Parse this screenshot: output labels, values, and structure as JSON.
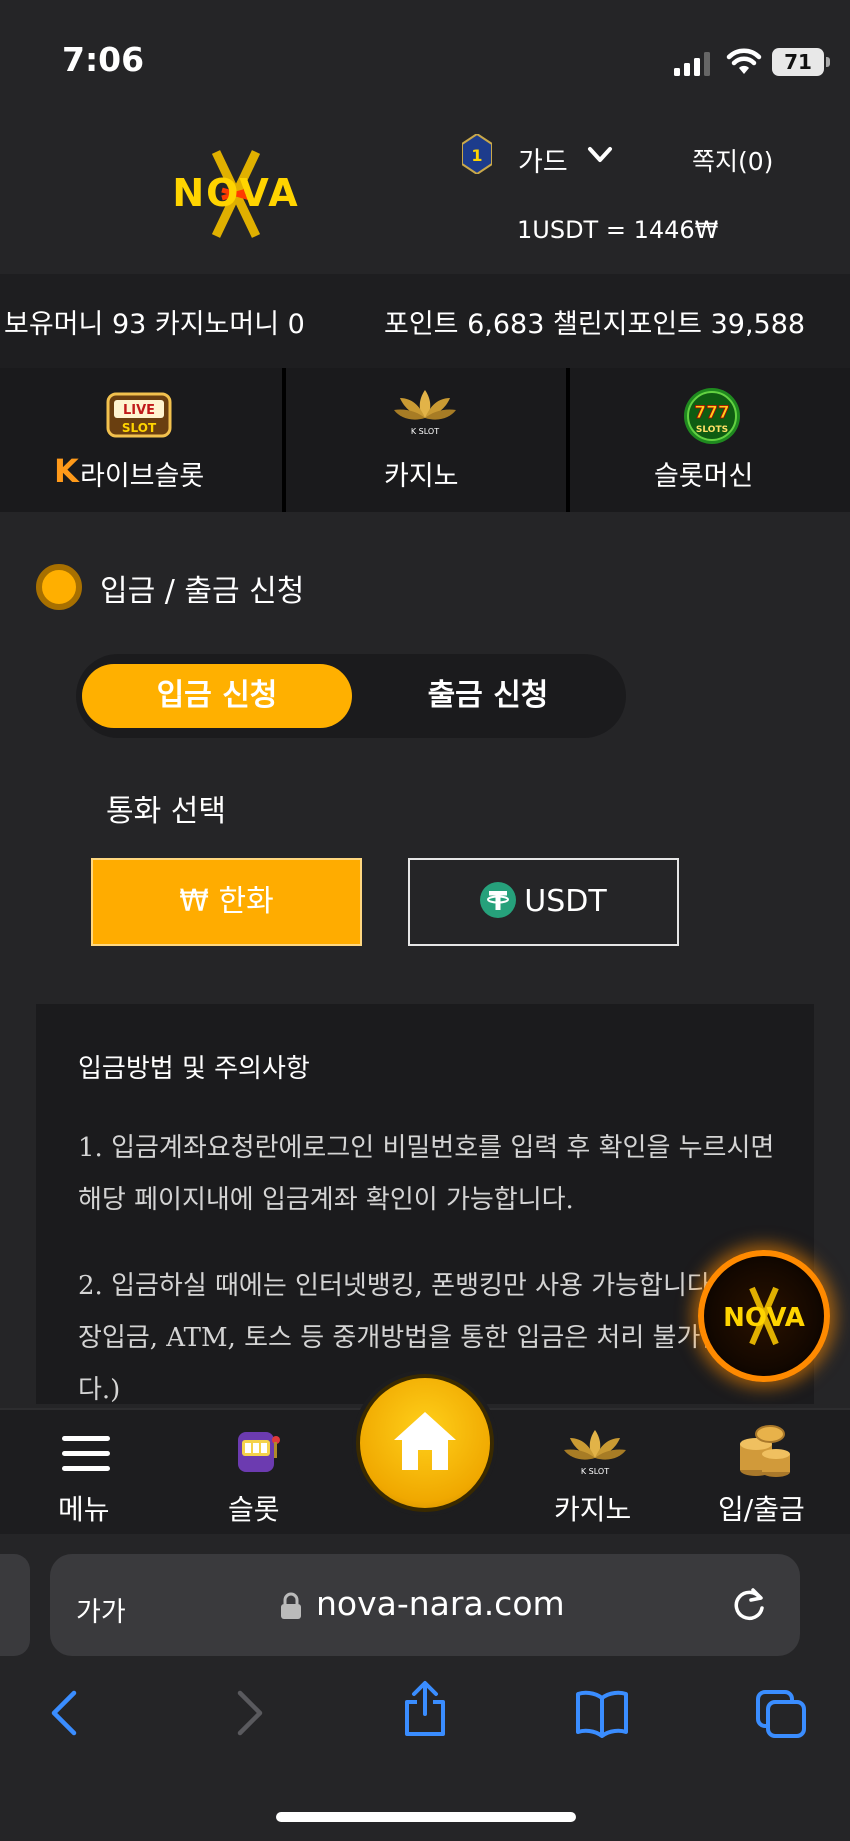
{
  "status_bar": {
    "time": "7:06",
    "battery": "71"
  },
  "header": {
    "logo_text": "NOVA",
    "level_badge": "1",
    "level_name": "가드",
    "message_link": "쪽지(0)",
    "usdt_rate": "1USDT = 1446₩"
  },
  "balances": {
    "left": "보유머니 93 카지노머니 0",
    "right": "포인트 6,683 챌린지포인트 39,588"
  },
  "categories": [
    {
      "icon": "live-slot-icon",
      "icon_text": "LIVE",
      "icon_subtext": "SLOT",
      "label": "라이브슬롯",
      "prefix": "K"
    },
    {
      "icon": "k-slot-lotus-icon",
      "icon_text": "K SLOT",
      "label": "카지노"
    },
    {
      "icon": "777-slots-icon",
      "icon_text": "777",
      "icon_subtext": "SLOTS",
      "label": "슬롯머신"
    }
  ],
  "section": {
    "title": "입금 / 출금 신청",
    "tabs": {
      "deposit": "입금 신청",
      "withdraw": "출금 신청"
    },
    "currency_title": "통화 선택",
    "currency_krw": "₩ 한화",
    "currency_usdt": "USDT"
  },
  "notice": {
    "title": "입금방법 및 주의사항",
    "p1": "1. 입금계좌요청란에로그인 비밀번호를 입력 후 확인을 누르시면 해당 페이지내에 입금계좌 확인이 가능합니다.",
    "p2": "2. 입금하실 때에는 인터넷뱅킹, 폰뱅킹만 사용 가능합니다.(무통장입금, ATM, 토스 등 중개방법을 통한 입금은 처리 불가합니다.)"
  },
  "bottom_nav": {
    "menu": "메뉴",
    "slot": "슬롯",
    "casino": "카지노",
    "banking": "입/출금",
    "casino_icon_text": "K SLOT"
  },
  "browser": {
    "text_size": "가가",
    "url": "nova-nara.com"
  },
  "colors": {
    "accent": "#ffb000",
    "background": "#252527",
    "panel": "#1b1b1d",
    "tether": "#26a17b"
  }
}
